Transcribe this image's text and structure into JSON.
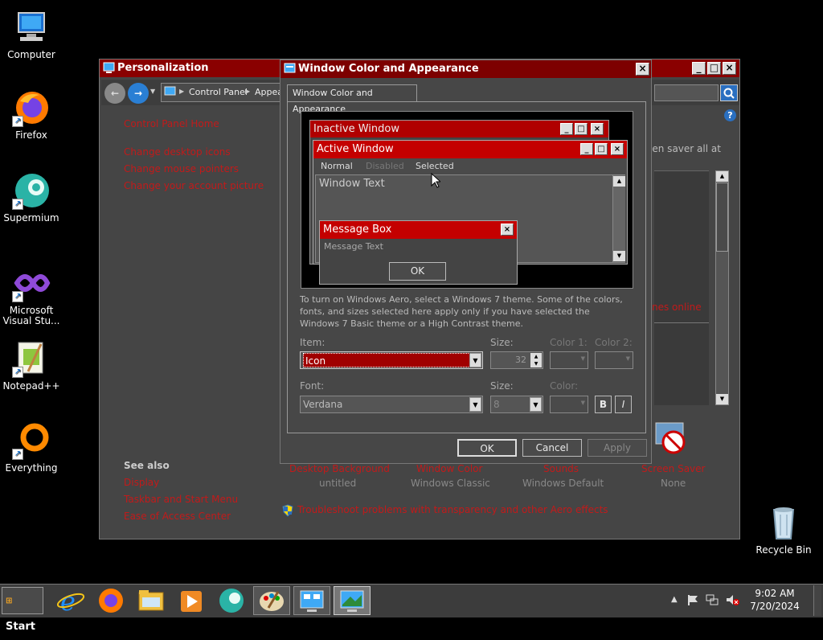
{
  "desktop": {
    "icons": [
      {
        "label": "Computer"
      },
      {
        "label": "Firefox"
      },
      {
        "label": "Supermium"
      },
      {
        "label": "Microsoft Visual Stu..."
      },
      {
        "label": "Notepad++"
      },
      {
        "label": "Everything"
      },
      {
        "label": "Recycle Bin"
      }
    ]
  },
  "personalization": {
    "title": "Personalization",
    "breadcrumb": [
      "Control Panel",
      "Appea"
    ],
    "sidebar_home": "Control Panel Home",
    "sidebar_links": [
      "Change desktop icons",
      "Change mouse pointers",
      "Change your account picture"
    ],
    "see_also_title": "See also",
    "see_also_links": [
      "Display",
      "Taskbar and Start Menu",
      "Ease of Access Center"
    ],
    "right_text": "een saver all at",
    "themes_online": "nes online",
    "bottom_items": [
      {
        "label": "Desktop Background",
        "value": "untitled"
      },
      {
        "label": "Window Color",
        "value": "Windows Classic"
      },
      {
        "label": "Sounds",
        "value": "Windows Default"
      },
      {
        "label": "Screen Saver",
        "value": "None"
      }
    ],
    "troubleshoot": "Troubleshoot problems with transparency and other Aero effects"
  },
  "dialog": {
    "title": "Window Color and Appearance",
    "tab": "Window Color and Appearance",
    "preview": {
      "inactive_title": "Inactive Window",
      "active_title": "Active Window",
      "menu": [
        "Normal",
        "Disabled",
        "Selected"
      ],
      "window_text": "Window Text",
      "msgbox_title": "Message Box",
      "msgbox_text": "Message Text",
      "ok": "OK"
    },
    "info": "To turn on Windows Aero, select a Windows 7 theme.  Some of the colors, fonts, and sizes selected here apply only if you have selected the Windows 7 Basic theme or a High Contrast theme.",
    "item_label": "Item:",
    "item_value": "Icon",
    "size_label": "Size:",
    "size_value": "32",
    "color1_label": "Color 1:",
    "color2_label": "Color 2:",
    "font_label": "Font:",
    "font_value": "Verdana",
    "font_size_label": "Size:",
    "font_size_value": "8",
    "font_color_label": "Color:",
    "bold": "B",
    "italic": "I",
    "ok": "OK",
    "cancel": "Cancel",
    "apply": "Apply"
  },
  "taskbar": {
    "start": "Start",
    "time": "9:02 AM",
    "date": "7/20/2024"
  },
  "colors": {
    "titlebar": "#8a0000",
    "link": "#c21a1a",
    "window_bg": "#454545"
  }
}
